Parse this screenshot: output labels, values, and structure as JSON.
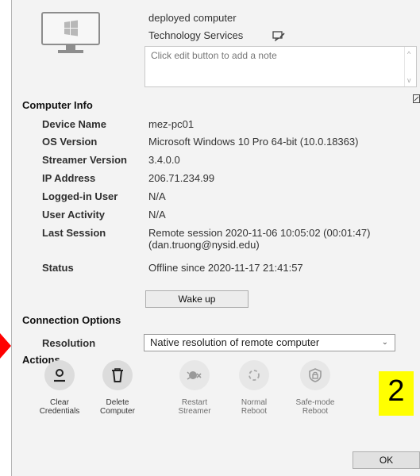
{
  "header": {
    "line1": "deployed computer",
    "line2": "Technology Services",
    "icon": "device-rename-icon"
  },
  "note": {
    "placeholder": "Click edit button to add a note"
  },
  "computer_info": {
    "title": "Computer Info",
    "rows": [
      {
        "label": "Device Name",
        "value": "mez-pc01"
      },
      {
        "label": "OS Version",
        "value": "Microsoft Windows 10 Pro 64-bit (10.0.18363)"
      },
      {
        "label": "Streamer Version",
        "value": "3.4.0.0"
      },
      {
        "label": "IP Address",
        "value": "206.71.234.99"
      },
      {
        "label": "Logged-in User",
        "value": "N/A"
      },
      {
        "label": "User Activity",
        "value": "N/A"
      },
      {
        "label": "Last Session",
        "value": "Remote session 2020-11-06 10:05:02 (00:01:47)",
        "value2": "(dan.truong@nysid.edu)"
      },
      {
        "label": "Status",
        "value": "Offline since 2020-11-17 21:41:57"
      }
    ]
  },
  "wake_button": "Wake up",
  "connection_options": {
    "title": "Connection Options",
    "resolution_label": "Resolution",
    "resolution_value": "Native resolution of remote computer"
  },
  "actions": {
    "title": "Actions",
    "items": [
      {
        "line1": "Clear",
        "line2": "Credentials",
        "icon": "user-icon",
        "enabled": true
      },
      {
        "line1": "Delete",
        "line2": "Computer",
        "icon": "trash-icon",
        "enabled": true
      },
      {
        "line1": "Restart",
        "line2": "Streamer",
        "icon": "restart-streamer-icon",
        "enabled": false
      },
      {
        "line1": "Normal",
        "line2": "Reboot",
        "icon": "reboot-icon",
        "enabled": false
      },
      {
        "line1": "Safe-mode",
        "line2": "Reboot",
        "icon": "shield-lock-icon",
        "enabled": false
      }
    ]
  },
  "annotation_number": "2",
  "ok_button": "OK",
  "colors": {
    "annotation": "#ffff00",
    "marker": "#ff0000"
  }
}
